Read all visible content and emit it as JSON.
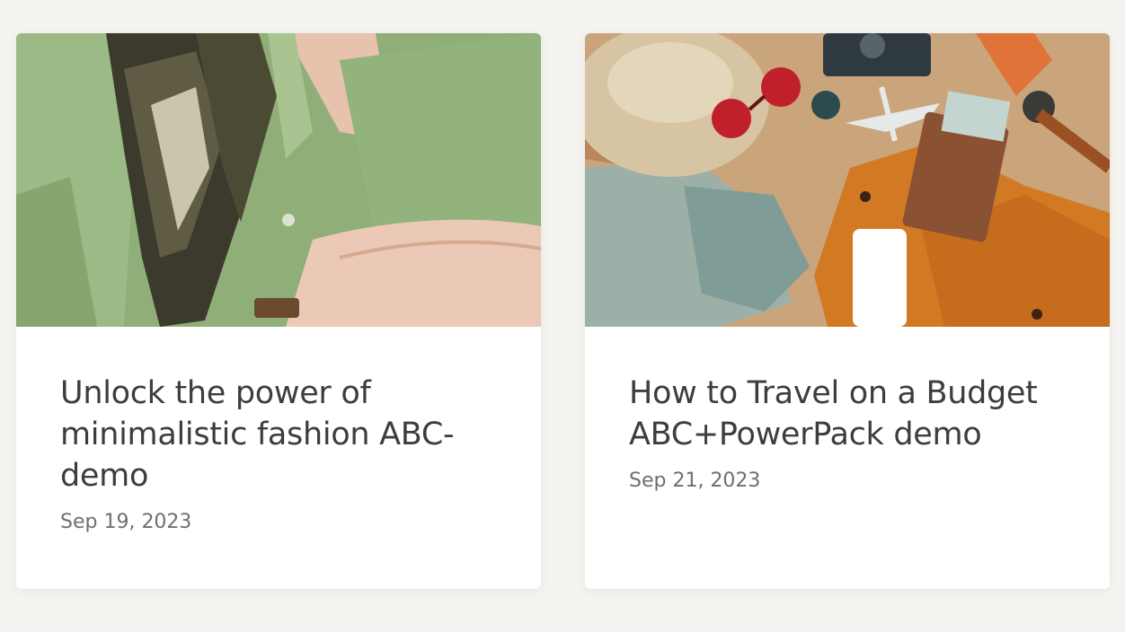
{
  "posts": [
    {
      "title": "Unlock the power of minimalistic fashion ABC-demo",
      "date": "Sep 19, 2023",
      "image_subject": "person in green shirt with patterned scarf"
    },
    {
      "title": "How to Travel on a Budget ABC+PowerPack demo",
      "date": "Sep 21, 2023",
      "image_subject": "world map with straw hat, sunglasses, passport wallet and toy plane"
    }
  ],
  "colors": {
    "page_background": "#f5f3ef",
    "card_background": "#ffffff",
    "title_text": "#3d3d3d",
    "date_text": "#6f6f6f"
  }
}
